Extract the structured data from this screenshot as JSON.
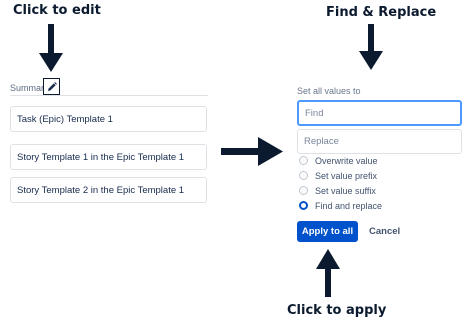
{
  "callouts": {
    "edit": "Click to edit",
    "find_replace": "Find & Replace",
    "apply": "Click to apply"
  },
  "field": {
    "label": "Summary",
    "edit_icon": "pencil-icon"
  },
  "rows": [
    {
      "value": "Task (Epic) Template 1"
    },
    {
      "value": "Story Template 1 in the Epic Template 1"
    },
    {
      "value": "Story Template 2 in the Epic Template 1"
    }
  ],
  "panel": {
    "heading": "Set all values to",
    "find_placeholder": "Find",
    "replace_placeholder": "Replace",
    "options": [
      {
        "label": "Overwrite value",
        "selected": false
      },
      {
        "label": "Set value prefix",
        "selected": false
      },
      {
        "label": "Set value suffix",
        "selected": false
      },
      {
        "label": "Find and replace",
        "selected": true
      }
    ],
    "apply_label": "Apply to all",
    "cancel_label": "Cancel"
  },
  "colors": {
    "accent": "#0052cc",
    "arrow": "#0b1a2e",
    "focus_border": "#4c9aff"
  }
}
